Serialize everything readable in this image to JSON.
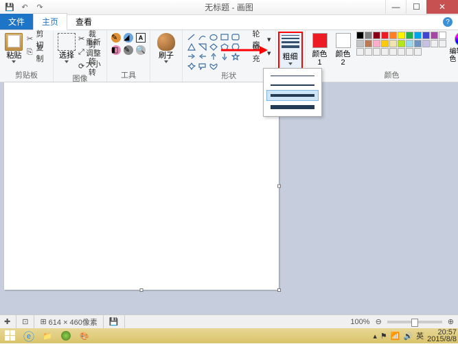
{
  "title": "无标题 - 画图",
  "tabs": {
    "file": "文件",
    "home": "主页",
    "view": "查看"
  },
  "clipboard": {
    "paste": "粘贴",
    "cut": "剪切",
    "copy": "复制",
    "label": "剪贴板"
  },
  "image": {
    "select": "选择",
    "crop": "裁剪",
    "resize": "重新调整大小",
    "rotate": "旋转",
    "label": "图像"
  },
  "tools": {
    "label": "工具"
  },
  "brush": {
    "label": "刷子"
  },
  "shapes": {
    "outline": "轮廓",
    "fill": "填充",
    "label": "形状"
  },
  "size": {
    "label": "粗细"
  },
  "colors": {
    "c1": "颜色 1",
    "c2": "颜色 2",
    "edit": "编辑颜色",
    "label": "颜色",
    "row1": [
      "#000000",
      "#7f7f7f",
      "#880015",
      "#ed1c24",
      "#ff7f27",
      "#fff200",
      "#22b14c",
      "#00a2e8",
      "#3f48cc",
      "#a349a4"
    ],
    "row2": [
      "#ffffff",
      "#c3c3c3",
      "#b97a57",
      "#ffaec9",
      "#ffc90e",
      "#efe4b0",
      "#b5e61d",
      "#99d9ea",
      "#7092be",
      "#c8bfe7"
    ],
    "row3": [
      "#f0f0f0",
      "#f0f0f0",
      "#f0f0f0",
      "#f0f0f0",
      "#f0f0f0",
      "#f0f0f0",
      "#f0f0f0",
      "#f0f0f0",
      "#f0f0f0",
      "#f0f0f0"
    ]
  },
  "status": {
    "dims": "614 × 460像素",
    "zoom": "100%"
  },
  "tray": {
    "ime": "英",
    "time": "20:57",
    "date": "2015/8/8"
  }
}
